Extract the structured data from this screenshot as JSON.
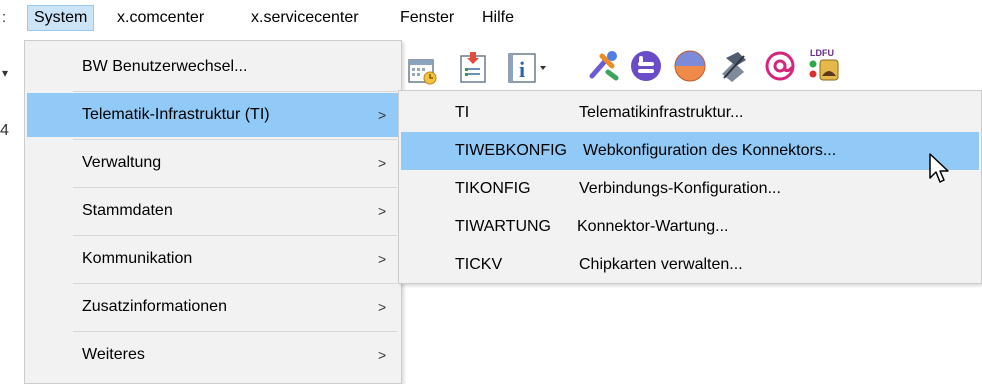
{
  "menubar": {
    "left_fragment": ":",
    "items": [
      "System",
      "x.comcenter",
      "x.servicecenter",
      "Fenster",
      "Hilfe"
    ]
  },
  "left_edge": {
    "arrow": "▾",
    "digit": "4"
  },
  "system_menu": {
    "items": [
      {
        "label": "BW  Benutzerwechsel...",
        "submenu": false
      },
      {
        "label": "Telematik-Infrastruktur (TI)",
        "submenu": true
      },
      {
        "label": "Verwaltung",
        "submenu": true
      },
      {
        "label": "Stammdaten",
        "submenu": true
      },
      {
        "label": "Kommunikation",
        "submenu": true
      },
      {
        "label": "Zusatzinformationen",
        "submenu": true
      },
      {
        "label": "Weiteres",
        "submenu": true
      }
    ],
    "arrow": ">"
  },
  "ti_submenu": {
    "items": [
      {
        "code": "TI",
        "desc": "Telematikinfrastruktur..."
      },
      {
        "code": "TIWEBKONFIG",
        "desc": "Webkonfiguration des Konnektors..."
      },
      {
        "code": "TIKONFIG",
        "desc": "Verbindungs-Konfiguration..."
      },
      {
        "code": "TIWARTUNG",
        "desc": "Konnektor-Wartung..."
      },
      {
        "code": "TICKV",
        "desc": "Chipkarten verwalten..."
      }
    ]
  },
  "toolbar": {
    "icons": [
      "calendar-icon",
      "clipboard-icon",
      "info-icon",
      "tools-icon",
      "blue-circle-icon",
      "globe-icon",
      "satellite-icon",
      "at-sign-icon",
      "ldfu-icon"
    ],
    "ldfu_label": "LDFU"
  },
  "colors": {
    "highlight": "#91c9f7",
    "menu_bg": "#f2f2f2",
    "active_menubar": "#cce4f7"
  }
}
